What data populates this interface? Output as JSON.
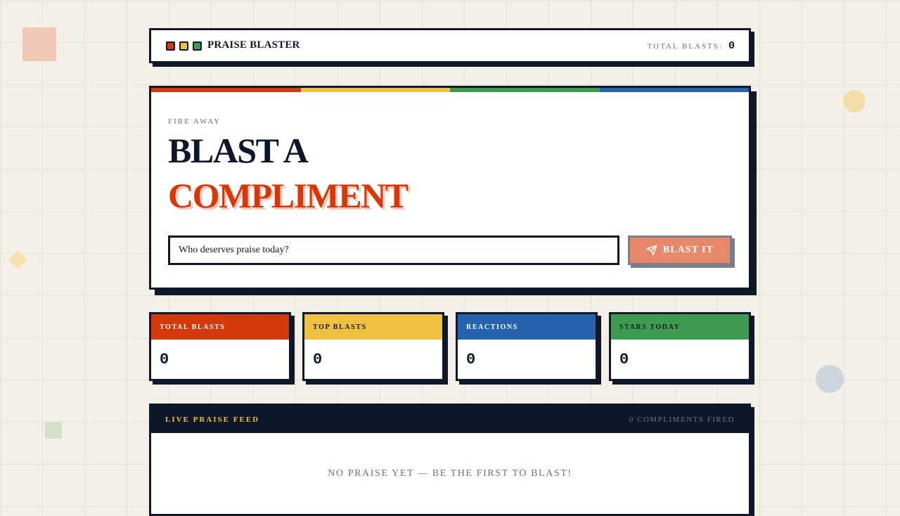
{
  "header": {
    "brand": "PRAISE BLASTER",
    "total_label": "TOTAL BLASTS:",
    "total_value": "0"
  },
  "hero": {
    "eyebrow": "FIRE AWAY",
    "title_line1": "BLAST A",
    "title_line2": "COMPLIMENT",
    "input_value": "Who deserves praise today?",
    "button_label": "BLAST IT"
  },
  "stats": [
    {
      "label": "TOTAL BLASTS",
      "value": "0",
      "color": "#d4380d"
    },
    {
      "label": "TOP BLASTS",
      "value": "0",
      "color": "#f0c040"
    },
    {
      "label": "REACTIONS",
      "value": "0",
      "color": "#2563ae"
    },
    {
      "label": "STARS TODAY",
      "value": "0",
      "color": "#3f9b50"
    }
  ],
  "feed": {
    "title": "LIVE PRAISE FEED",
    "count": "0 COMPLIMENTS FIRED",
    "empty_message": "NO PRAISE YET — BE THE FIRST TO BLAST!"
  },
  "colors": {
    "red": "#d4380d",
    "yellow": "#f0c040",
    "green": "#3f9b50",
    "blue": "#2563ae",
    "navy": "#0f172a",
    "background": "#f5f0e7",
    "button": "#e8886b"
  },
  "icons": {
    "button_icon": "send-icon"
  }
}
